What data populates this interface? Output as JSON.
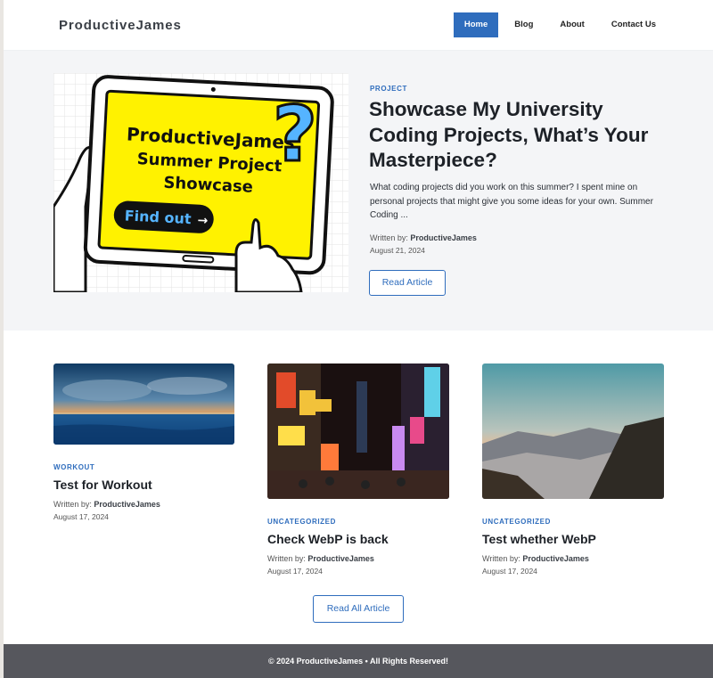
{
  "site": {
    "logo": "ProductiveJames"
  },
  "nav": {
    "items": [
      {
        "label": "Home",
        "active": true
      },
      {
        "label": "Blog",
        "active": false
      },
      {
        "label": "About",
        "active": false
      },
      {
        "label": "Contact Us",
        "active": false
      }
    ]
  },
  "hero": {
    "image_text": {
      "line1": "ProductiveJames",
      "line2": "Summer Project",
      "line3": "Showcase",
      "cta": "Find out"
    },
    "category": "PROJECT",
    "title": "Showcase My University Coding Projects, What’s Your Masterpiece?",
    "excerpt": "What coding projects did you work on this summer? I spent mine on personal projects that might give you some ideas for your own. Summer Coding ...",
    "written_by_label": "Written by:",
    "author": "ProductiveJames",
    "date": "August 21, 2024",
    "button": "Read Article"
  },
  "posts": [
    {
      "category": "WORKOUT",
      "title": "Test for Workout",
      "written_by_label": "Written by:",
      "author": "ProductiveJames",
      "date": "August 17, 2024"
    },
    {
      "category": "UNCATEGORIZED",
      "title": "Check WebP is back",
      "written_by_label": "Written by:",
      "author": "ProductiveJames",
      "date": "August 17, 2024"
    },
    {
      "category": "UNCATEGORIZED",
      "title": "Test whether WebP",
      "written_by_label": "Written by:",
      "author": "ProductiveJames",
      "date": "August 17, 2024"
    }
  ],
  "read_all": "Read All Article",
  "footer": {
    "text": "© 2024 ProductiveJames • All Rights Reserved!"
  },
  "colors": {
    "accent": "#2f6dbd",
    "hero_bg": "#f4f5f7",
    "footer_bg": "#56575d",
    "tablet_screen": "#fff200"
  }
}
